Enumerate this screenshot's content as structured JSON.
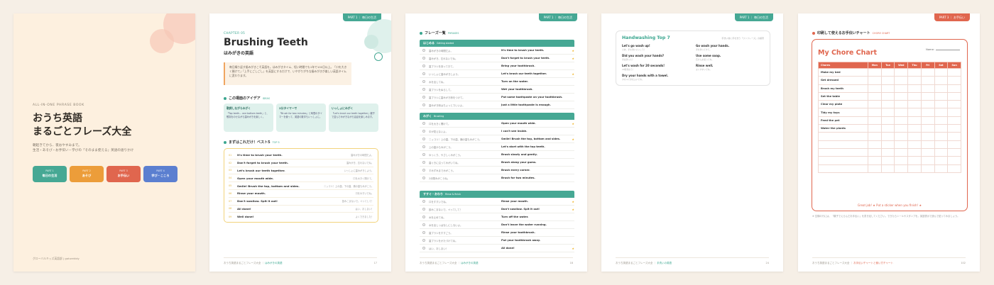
{
  "colors": {
    "teal": "#46a894",
    "orange": "#f0a040",
    "coral": "#e0664e",
    "blue": "#5b7fd0",
    "cream": "#fdf0df"
  },
  "cover": {
    "kicker": "ALL-IN-ONE PHRASE BOOK",
    "title_line1": "おうち英語",
    "title_line2": "まるごとフレーズ大全",
    "sub_line1": "朝起きてから、夜おやすみまで。",
    "sub_line2": "生活・あそび・お手伝い・学びの「そのまま使える」英語の語りかけ",
    "buttons": [
      {
        "k": "PART 1",
        "l": "毎日の生活"
      },
      {
        "k": "PART 2",
        "l": "あそび"
      },
      {
        "k": "PART 3",
        "l": "お手伝い"
      },
      {
        "k": "PART 4",
        "l": "学び・こころ"
      }
    ],
    "credit": "グローバルキッズ英語部 | goturekidy"
  },
  "chapter": {
    "tag": "PART 1 ｜ 毎日の生活",
    "kicker": "CHAPTER 05",
    "title": "Brushing Teeth",
    "subtitle": "はみがきの英語",
    "intro": "毎日繰り返す歯みがきこそ英語を。はみがきタイム、短い時間でも1年で100日以上。「口を大きく開けて」「上手にごしごし」を英語にするだけで、いやがりがちな歯みがきが楽しい英語タイムに変わります。",
    "ideas_title": "この場面のアイデア",
    "ideas_en": "IDEAS",
    "ideas": [
      {
        "t": "歌詞しながらみがく",
        "d": "「Top teeth… one bottom teeth」と、歌詞をのせながら歯みがきを楽しく。"
      },
      {
        "t": "2分タイマーで",
        "d": "「Brush for two minutes」と時間のタイマーを使って、英語の数字もいっしょに。"
      },
      {
        "t": "いっしょにみがく",
        "d": "「Let's brush our teeth together」親子で並んでみがきながら会話を楽しみます。"
      }
    ],
    "top5_title": "まずはこれだけ！ベスト5",
    "top5_en": "TOP 5",
    "top5": [
      {
        "n": "01",
        "en": "It's time to brush your teeth.",
        "ja": "歯みがきの時間だよ。"
      },
      {
        "n": "02",
        "en": "Don't forget to brush your teeth.",
        "ja": "歯みがき、忘れないでね。"
      },
      {
        "n": "03",
        "en": "Let's brush our teeth together.",
        "ja": "いっしょに歯みがきしよう。"
      },
      {
        "n": "04",
        "en": "Open your mouth wide.",
        "ja": "口を大きく開けて。"
      },
      {
        "n": "05",
        "en": "Smile! Brush the top, bottom and sides.",
        "ja": "ニッコリ！上の歯、下の歯、横の歯もみがこう。"
      },
      {
        "n": "06",
        "en": "Rinse your mouth.",
        "ja": "口をゆすいでね。"
      },
      {
        "n": "07",
        "en": "Don't swallow. Spit it out!",
        "ja": "飲みこまないで。ぺってして！"
      },
      {
        "n": "08",
        "en": "All done!",
        "ja": "はい、おしまい！"
      },
      {
        "n": "09",
        "en": "Well done!",
        "ja": "よくできました！"
      }
    ],
    "footer_book": "おうち英語まるごとフレーズ大全 ｜ ",
    "footer_section": "はみがきの英語",
    "page": "17"
  },
  "phrases": {
    "tag": "PART 1 ｜ 毎日の生活",
    "title": "フレーズ一覧",
    "title_en": "PHRASES",
    "groups": [
      {
        "name": "はじめる",
        "en": "Getting started",
        "rows": [
          {
            "ja": "歯みがきの時間だよ。",
            "en": "It's time to brush your teeth.",
            "star": true
          },
          {
            "ja": "歯みがき、忘れないでね。",
            "en": "Don't forget to brush your teeth.",
            "star": true
          },
          {
            "ja": "歯ブラシを持ってきて。",
            "en": "Bring your toothbrush.",
            "star": false
          },
          {
            "ja": "いっしょに歯みがきしよう。",
            "en": "Let's brush our teeth together.",
            "star": true
          },
          {
            "ja": "水を出してね。",
            "en": "Turn on the water.",
            "star": false
          },
          {
            "ja": "歯ブラシをぬらして。",
            "en": "Wet your toothbrush.",
            "star": false
          },
          {
            "ja": "歯ブラシに歯みがき粉をつけて。",
            "en": "Put some toothpaste on your toothbrush.",
            "star": false
          },
          {
            "ja": "歯みがき粉はちょっとでいいよ。",
            "en": "Just a little toothpaste is enough.",
            "star": false
          }
        ]
      },
      {
        "name": "みがく",
        "en": "Brushing",
        "rows": [
          {
            "ja": "口を大きく開けて。",
            "en": "Open your mouth wide.",
            "star": true
          },
          {
            "ja": "中が見えないよ。",
            "en": "I can't see inside.",
            "star": false
          },
          {
            "ja": "ニッコリ！上の歯、下の歯、横の歯もみがこう。",
            "en": "Smile! Brush the top, bottom and sides.",
            "star": true
          },
          {
            "ja": "上の歯からみがこう。",
            "en": "Let's start with the top teeth.",
            "star": false
          },
          {
            "ja": "ゆっくり、やさしくみがこう。",
            "en": "Brush slowly and gently.",
            "star": false
          },
          {
            "ja": "歯ぐきに沿ってみがいてね。",
            "en": "Brush along your gums.",
            "star": false
          },
          {
            "ja": "すみずみまでみがこう。",
            "en": "Brush every corner.",
            "star": false
          },
          {
            "ja": "2分間みがこうね。",
            "en": "Brush for two minutes.",
            "star": false
          }
        ]
      },
      {
        "name": "すすぐ・おわり",
        "en": "Rinse & finish",
        "rows": [
          {
            "ja": "口をすすいでね。",
            "en": "Rinse your mouth.",
            "star": true
          },
          {
            "ja": "飲みこまないで。ぺってして！",
            "en": "Don't swallow. Spit it out!",
            "star": true
          },
          {
            "ja": "水を止めてね。",
            "en": "Turn off the water.",
            "star": false
          },
          {
            "ja": "水を出しっぱなしにしないよ。",
            "en": "Don't leave the water running.",
            "star": false
          },
          {
            "ja": "歯ブラシをすすごう。",
            "en": "Rinse your toothbrush.",
            "star": false
          },
          {
            "ja": "歯ブラシをかたづけてね。",
            "en": "Put your toothbrush away.",
            "star": false
          },
          {
            "ja": "はい、おしまい！",
            "en": "All done!",
            "star": true
          }
        ]
      }
    ],
    "footer_book": "おうち英語まるごとフレーズ大全 ｜ ",
    "footer_section": "はみがきの英語",
    "page": "18"
  },
  "handwash": {
    "tag": "PART 1 ｜ 毎日の生活",
    "title": "Handwashing Top 7",
    "note": "手洗い前に手を洗う「ワンフレーズ」の練習",
    "items": [
      {
        "en": "Let's go wash up!",
        "ja": "さあ、手を洗いにいこう！"
      },
      {
        "en": "Go wash your hands.",
        "ja": "手を洗ってきて。"
      },
      {
        "en": "Did you wash your hands?",
        "ja": "手は洗った？"
      },
      {
        "en": "Use some soap.",
        "ja": "石けんを使ってね。"
      },
      {
        "en": "Let's wash for 20 seconds!",
        "ja": "20秒洗おう！"
      },
      {
        "en": "Rinse well.",
        "ja": "よくすすいでね。"
      },
      {
        "en": "Dry your hands with a towel.",
        "ja": "タオルで手をふいてね。"
      }
    ],
    "footer_book": "おうち英語まるごとフレーズ大全 ｜ ",
    "footer_section": "手洗いの英語",
    "page": "24"
  },
  "chore": {
    "tag": "PART 3 ｜ お手伝い",
    "head": "印刷して使えるお手伝いチャート",
    "head_en": "CHORE CHART",
    "title": "My Chore Chart",
    "name_label": "Name:",
    "col0": "Chores",
    "days": [
      "Mon",
      "Tue",
      "Wed",
      "Thu",
      "Fri",
      "Sat",
      "Sun"
    ],
    "chores": [
      "Make my bed",
      "Get dressed",
      "Brush my teeth",
      "Set the table",
      "Clear my plate",
      "Tidy my toys",
      "Feed the pet",
      "Water the plants",
      "",
      "",
      "",
      "",
      ""
    ],
    "foot": "Great job! ★ Put a sticker when you finish! ★",
    "note": "※ 空欄の行には、「親子でえらんだお手伝い」を書き足してください。できたらシールやスタンプを。英語表示で読んで貼ってみましょう。",
    "footer_book": "おうち英語まるごとフレーズ大全 ｜ ",
    "footer_section": "お手伝いチャートと使い方チャート",
    "page": "102"
  }
}
